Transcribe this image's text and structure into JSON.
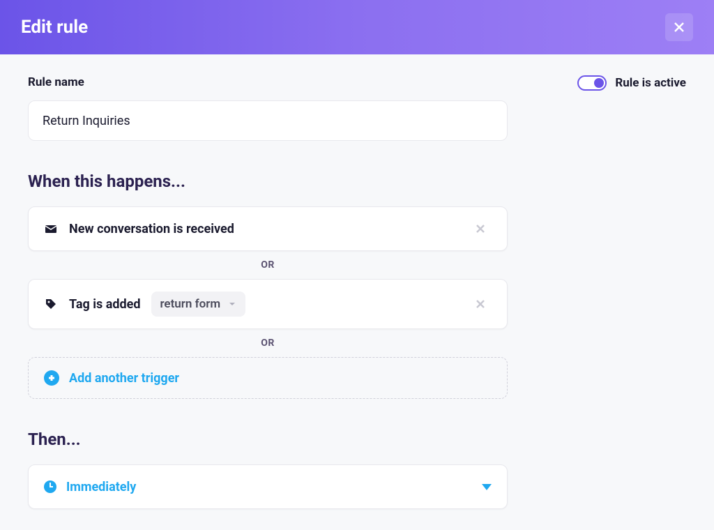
{
  "header": {
    "title": "Edit rule"
  },
  "toggle": {
    "label": "Rule is active",
    "on": true
  },
  "ruleName": {
    "label": "Rule name",
    "value": "Return Inquiries"
  },
  "triggers": {
    "heading": "When this happens...",
    "separator": "OR",
    "items": [
      {
        "icon": "mail-icon",
        "text": "New conversation is received"
      },
      {
        "icon": "tag-icon",
        "text": "Tag is added",
        "tag": "return form"
      }
    ],
    "addLabel": "Add another trigger"
  },
  "then": {
    "heading": "Then...",
    "timing": "Immediately"
  }
}
